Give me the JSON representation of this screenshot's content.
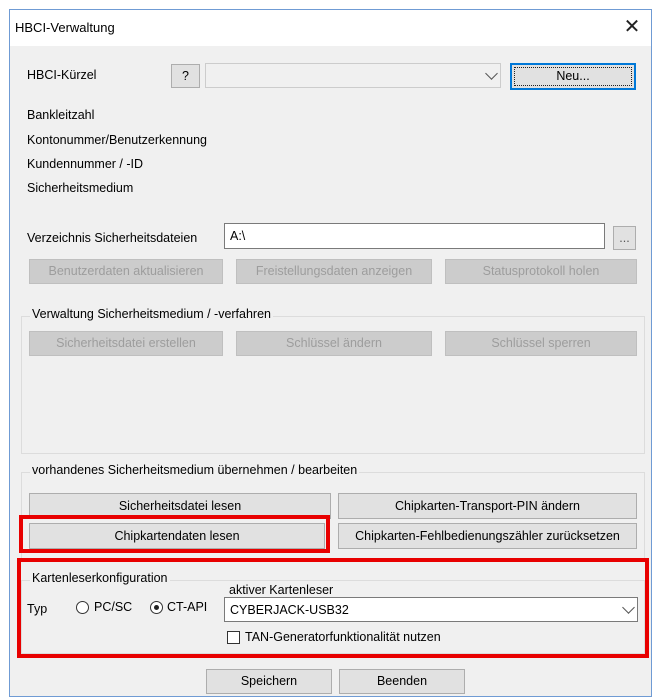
{
  "window": {
    "title": "HBCI-Verwaltung",
    "close_glyph": "✕"
  },
  "form": {
    "hbci_kuerzel_label": "HBCI-Kürzel",
    "help_label": "?",
    "hbci_kuerzel_value": "",
    "new_label": "Neu...",
    "bankleitzahl_label": "Bankleitzahl",
    "kontonummer_label": "Kontonummer/Benutzerkennung",
    "kundennummer_label": "Kundennummer / -ID",
    "sicherheitsmedium_label": "Sicherheitsmedium",
    "verzeichnis_label": "Verzeichnis Sicherheitsdateien",
    "verzeichnis_value": "A:\\",
    "browse_label": "...",
    "benutzerdaten_label": "Benutzerdaten aktualisieren",
    "freistellung_label": "Freistellungsdaten anzeigen",
    "statusprotokoll_label": "Statusprotokoll holen"
  },
  "group_verwaltung": {
    "title": "Verwaltung Sicherheitsmedium / -verfahren",
    "erstellen_label": "Sicherheitsdatei erstellen",
    "schluessel_aendern_label": "Schlüssel ändern",
    "schluessel_sperren_label": "Schlüssel sperren"
  },
  "group_vorhanden": {
    "title": "vorhandenes Sicherheitsmedium übernehmen / bearbeiten",
    "datei_lesen_label": "Sicherheitsdatei lesen",
    "transport_pin_label": "Chipkarten-Transport-PIN ändern",
    "chipkarte_lesen_label": "Chipkartendaten lesen",
    "fehlbedienung_label": "Chipkarten-Fehlbedienungszähler zurücksetzen"
  },
  "group_kartenleser": {
    "title": "Kartenleserkonfiguration",
    "typ_label": "Typ",
    "pcsc_label": "PC/SC",
    "ctapi_label": "CT-API",
    "selected_type": "CT-API",
    "aktiver_label": "aktiver Kartenleser",
    "aktiver_value": "CYBERJACK-USB32",
    "tan_label": "TAN-Generatorfunktionalität nutzen",
    "tan_checked": false
  },
  "footer": {
    "save_label": "Speichern",
    "exit_label": "Beenden"
  },
  "colors": {
    "highlight": "#e80000",
    "focus": "#0078d7",
    "window_border": "#6f9bd4"
  }
}
